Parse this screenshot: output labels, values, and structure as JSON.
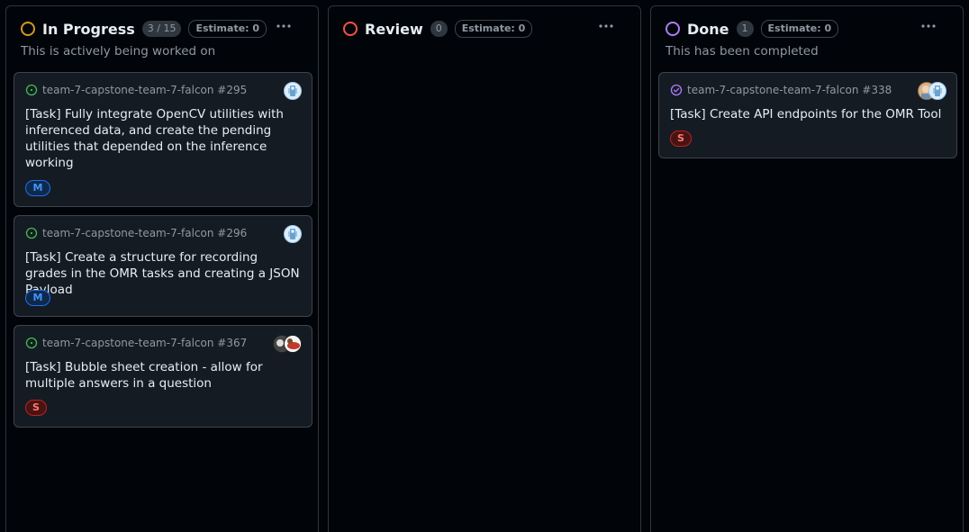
{
  "columns": [
    {
      "title": "In Progress",
      "count": "3 / 15",
      "estimate": "Estimate: 0",
      "description": "This is actively being worked on",
      "status_color": "#d29922",
      "cards": [
        {
          "repo_ref": "team-7-capstone-team-7-falcon #295",
          "title": "[Task] Fully integrate OpenCV utilities with inferenced data, and create the pending utilities that depended on the inference working",
          "size": "M",
          "state": "open",
          "avatar": "robot-avatar"
        },
        {
          "repo_ref": "team-7-capstone-team-7-falcon #296",
          "title": "[Task] Create a structure for recording grades in the OMR tasks and creating a JSON Payload",
          "size": "M",
          "state": "open",
          "avatar": "robot-avatar"
        },
        {
          "repo_ref": "team-7-capstone-team-7-falcon #367",
          "title": "[Task] Bubble sheet creation - allow for multiple answers in a question",
          "size": "S",
          "state": "open",
          "avatar": "photo-avatars"
        }
      ]
    },
    {
      "title": "Review",
      "count": "0",
      "estimate": "Estimate: 0",
      "description": "",
      "status_color": "#f85149",
      "cards": []
    },
    {
      "title": "Done",
      "count": "1",
      "estimate": "Estimate: 0",
      "description": "This has been completed",
      "status_color": "#ab7df8",
      "cards": [
        {
          "repo_ref": "team-7-capstone-team-7-falcon #338",
          "title": "[Task] Create API endpoints for the OMR Tool",
          "size": "S",
          "state": "closed",
          "avatar": "photo-and-robot-avatars"
        }
      ]
    }
  ]
}
